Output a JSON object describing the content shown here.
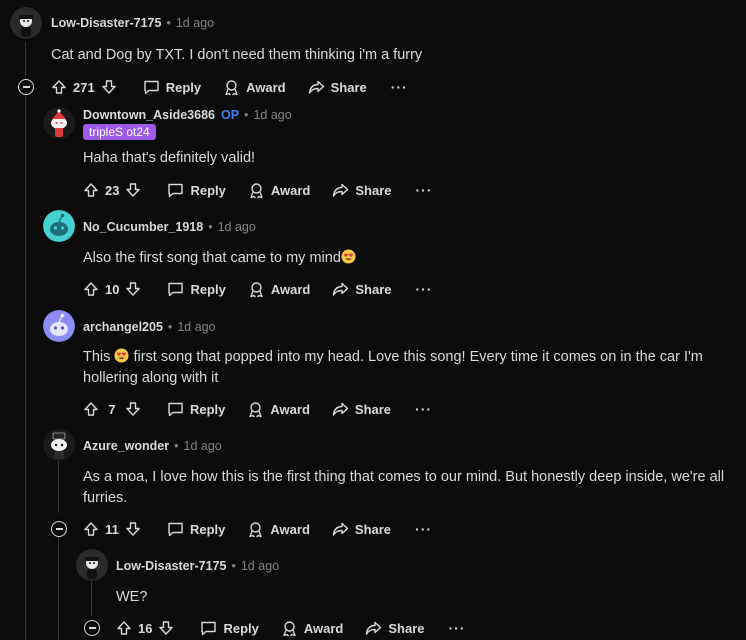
{
  "colors": {
    "background": "#0b0b0b",
    "text": "#d7dadc",
    "muted": "#818384",
    "op": "#3f7df0",
    "flair": "#9c5ae6"
  },
  "labels": {
    "reply": "Reply",
    "award": "Award",
    "share": "Share",
    "more": "···",
    "separator": "•"
  },
  "comments": [
    {
      "username": "Low-Disaster-7175",
      "time": "1d ago",
      "text": "Cat and Dog by TXT. I don't need them thinking i'm a furry",
      "score": "271",
      "avatar_icon": "snoo-avatar-dark"
    },
    {
      "username": "Downtown_Aside3686",
      "op": "OP",
      "flair": "tripleS ot24",
      "time": "1d ago",
      "text": "Haha that's definitely valid!",
      "score": "23",
      "avatar_icon": "snoo-avatar-santa"
    },
    {
      "username": "No_Cucumber_1918",
      "time": "1d ago",
      "text": "Also the first song that came to my mind",
      "emoji": "heart-eyes-emoji",
      "score": "10",
      "avatar_icon": "snoo-avatar-teal"
    },
    {
      "username": "archangel205",
      "time": "1d ago",
      "text_before_emoji": "This",
      "emoji": "heart-eyes-emoji",
      "text_after_emoji": "first song that popped into my head. Love this song! Every time it comes on in the car I'm hollering along with it",
      "score": "7",
      "avatar_icon": "snoo-avatar-purple"
    },
    {
      "username": "Azure_wonder",
      "time": "1d ago",
      "text": "As a moa, I love how this is the first thing that comes to our mind. But honestly deep inside, we're all furries.",
      "score": "11",
      "avatar_icon": "snoo-avatar-robot"
    },
    {
      "username": "Low-Disaster-7175",
      "time": "1d ago",
      "text": "WE?",
      "score": "16",
      "avatar_icon": "snoo-avatar-dark"
    }
  ]
}
